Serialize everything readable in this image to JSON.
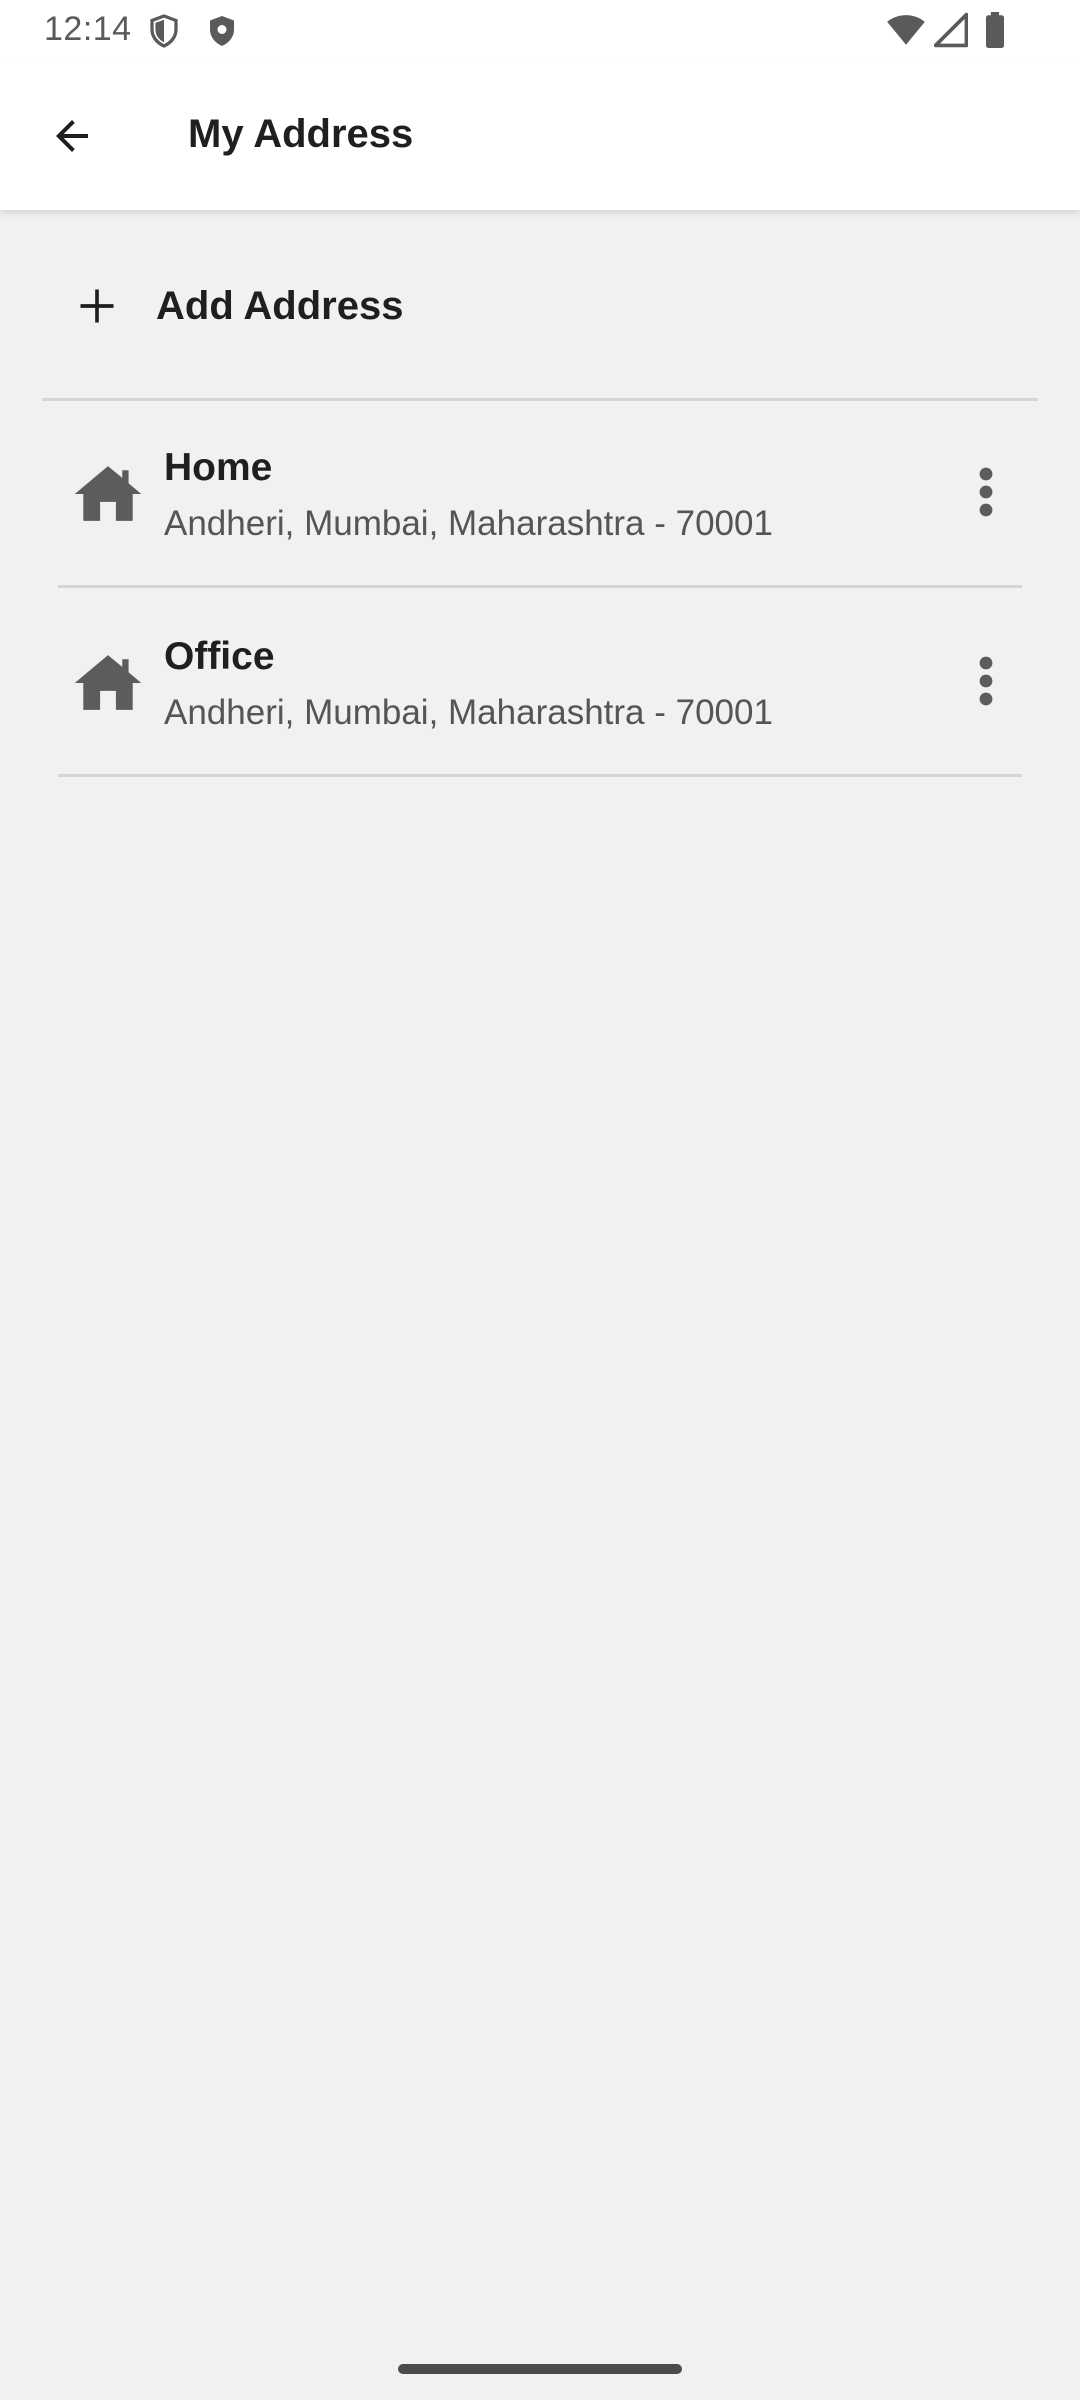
{
  "status_bar": {
    "time": "12:14",
    "icons": [
      "shield-outline-icon",
      "shield-filled-icon",
      "wifi-icon",
      "signal-icon",
      "battery-icon"
    ]
  },
  "app_bar": {
    "back_icon": "arrow-back-icon",
    "title": "My Address"
  },
  "add_address": {
    "icon": "plus-icon",
    "label": "Add Address"
  },
  "addresses": [
    {
      "icon": "home-icon",
      "name": "Home",
      "line": "Andheri, Mumbai, Maharashtra - 70001",
      "menu_icon": "more-vertical-icon"
    },
    {
      "icon": "home-icon",
      "name": "Office",
      "line": "Andheri, Mumbai, Maharashtra - 70001",
      "menu_icon": "more-vertical-icon"
    }
  ],
  "colors": {
    "background": "#f1f1f1",
    "surface": "#ffffff",
    "text_primary": "#1f1f1f",
    "text_secondary": "#555555",
    "icon": "#5c5c5c",
    "divider": "#d6d6d6"
  }
}
